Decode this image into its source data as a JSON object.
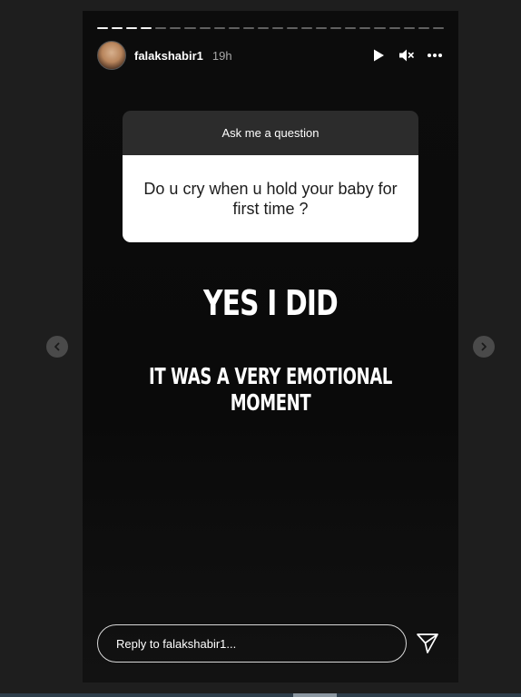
{
  "header": {
    "username": "falakshabir1",
    "time": "19h",
    "icons": {
      "play": "play-icon",
      "mute": "mute-icon",
      "more": "more-options-icon"
    }
  },
  "progress": {
    "segments_total": 24,
    "segments_done": 4
  },
  "question_sticker": {
    "title": "Ask me a question",
    "question": "Do u cry when u hold your baby for first time ?"
  },
  "answer": {
    "line1": "YES I DID",
    "line2": "IT WAS A VERY EMOTIONAL MOMENT"
  },
  "reply": {
    "placeholder": "Reply to falakshabir1...",
    "send_icon": "send-icon"
  },
  "navigation": {
    "prev_icon": "chevron-left-icon",
    "next_icon": "chevron-right-icon"
  },
  "colors": {
    "background": "#1e1e1e",
    "story_background": "#0b0b0b",
    "sticker_header": "#2c2c2c",
    "sticker_body": "#ffffff",
    "nav_button": "#4a4a4a"
  }
}
